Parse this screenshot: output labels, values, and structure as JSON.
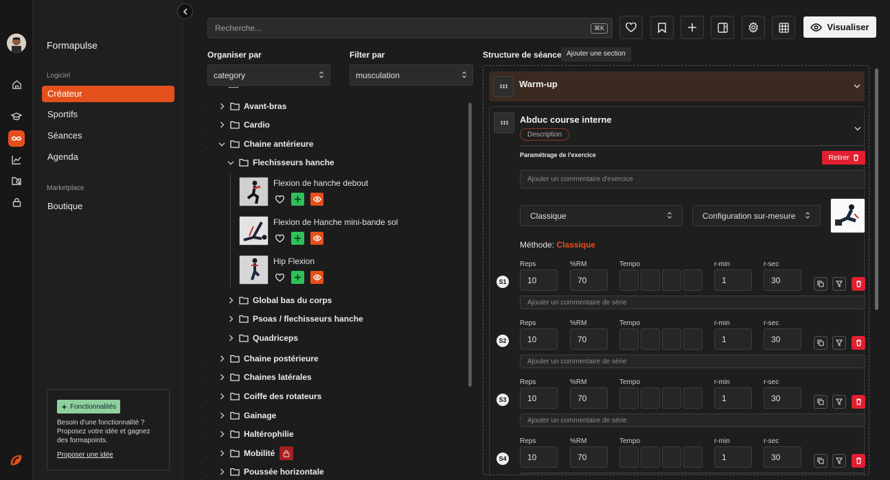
{
  "app": {
    "name": "Formapulse"
  },
  "sidebar": {
    "section1": "Logiciel",
    "items": [
      {
        "label": "Créateur",
        "active": true
      },
      {
        "label": "Sportifs"
      },
      {
        "label": "Séances"
      },
      {
        "label": "Agenda"
      }
    ],
    "section2": "Marketplace",
    "items2": [
      {
        "label": "Boutique"
      }
    ],
    "feature": {
      "badge": "Fonctionnalités",
      "text": "Besoin d'une fonctionnalité ? Proposez votre idée et gagnez des formapoints.",
      "link": "Proposer une idée"
    }
  },
  "toolbar": {
    "search_placeholder": "Recherche...",
    "shortcut": "⌘K",
    "visualize": "Visualiser"
  },
  "filters": {
    "organize_label": "Organiser par",
    "organize_value": "category",
    "filter_label": "Filter par",
    "filter_value": "musculation"
  },
  "tree": {
    "top": [
      {
        "label": "Avant-bras"
      },
      {
        "label": "Cardio"
      },
      {
        "label": "Chaine antérieure",
        "open": true
      }
    ],
    "sub_open": "Flechisseurs hanche",
    "exercises": [
      {
        "name": "Flexion de hanche debout"
      },
      {
        "name": "Flexion de Hanche mini-bande sol"
      },
      {
        "name": "Hip Flexion"
      }
    ],
    "sub_rest": [
      {
        "label": "Global bas du corps"
      },
      {
        "label": "Psoas / flechisseurs hanche"
      },
      {
        "label": "Quadriceps"
      }
    ],
    "bottom": [
      {
        "label": "Chaine postérieure"
      },
      {
        "label": "Chaines latérales"
      },
      {
        "label": "Coiffe des rotateurs"
      },
      {
        "label": "Gainage"
      },
      {
        "label": "Haltérophilie"
      },
      {
        "label": "Mobilité",
        "locked": true
      },
      {
        "label": "Poussée horizontale"
      }
    ]
  },
  "structure": {
    "title": "Structure de séance",
    "add_section": "Ajouter une section",
    "warmup": "Warm-up",
    "exercise": {
      "name": "Abduc course interne",
      "description_btn": "Description",
      "param_title": "Paramétrage de l'exercice",
      "remove_btn": "Retirer",
      "comment_placeholder": "Ajouter un commentaire d'exercice",
      "method_select": "Classique",
      "config_select": "Configuration sur-mesure",
      "method_label": "Méthode:",
      "method_value": "Classique",
      "columns": {
        "reps": "Reps",
        "rm": "%RM",
        "tempo": "Tempo",
        "rmin": "r-min",
        "rsec": "r-sec"
      },
      "series_comment_placeholder": "Ajouter un commentaire de série",
      "series": [
        {
          "label": "S1",
          "reps": "10",
          "rm": "70",
          "rmin": "1",
          "rsec": "30"
        },
        {
          "label": "S2",
          "reps": "10",
          "rm": "70",
          "rmin": "1",
          "rsec": "30"
        },
        {
          "label": "S3",
          "reps": "10",
          "rm": "70",
          "rmin": "1",
          "rsec": "30"
        },
        {
          "label": "S4",
          "reps": "10",
          "rm": "70",
          "rmin": "1",
          "rsec": "30"
        }
      ]
    }
  },
  "colors": {
    "accent": "#e4501c",
    "danger": "#e21f30",
    "add_green": "#2fc05a"
  }
}
